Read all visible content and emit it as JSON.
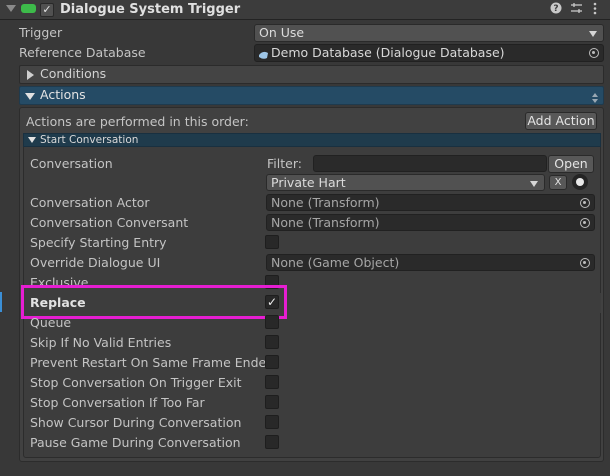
{
  "header": {
    "title": "Dialogue System Trigger"
  },
  "trigger": {
    "label": "Trigger",
    "value": "On Use"
  },
  "reference_database": {
    "label": "Reference Database",
    "value": "Demo Database (Dialogue Database)"
  },
  "conditions": {
    "label": "Conditions"
  },
  "actions": {
    "label": "Actions",
    "order_text": "Actions are performed in this order:",
    "add_action_label": "Add Action"
  },
  "start_conversation": {
    "label": "Start Conversation",
    "conversation": {
      "label": "Conversation",
      "filter_label": "Filter:",
      "filter_value": "",
      "open_label": "Open",
      "selected": "Private Hart",
      "clear_label": "X"
    },
    "conversation_actor": {
      "label": "Conversation Actor",
      "value": "None (Transform)"
    },
    "conversation_conversant": {
      "label": "Conversation Conversant",
      "value": "None (Transform)"
    },
    "specify_starting_entry": {
      "label": "Specify Starting Entry",
      "checked": false
    },
    "override_dialogue_ui": {
      "label": "Override Dialogue UI",
      "value": "None (Game Object)"
    },
    "exclusive": {
      "label": "Exclusive",
      "checked": false
    },
    "replace": {
      "label": "Replace",
      "checked": true
    },
    "queue": {
      "label": "Queue",
      "checked": false
    },
    "skip_if_no_valid_entries": {
      "label": "Skip If No Valid Entries",
      "checked": false
    },
    "prevent_restart": {
      "label": "Prevent Restart On Same Frame Ended",
      "checked": false
    },
    "stop_on_trigger_exit": {
      "label": "Stop Conversation On Trigger Exit",
      "checked": false
    },
    "stop_if_too_far": {
      "label": "Stop Conversation If Too Far",
      "checked": false
    },
    "show_cursor": {
      "label": "Show Cursor During Conversation",
      "checked": false
    },
    "pause_game": {
      "label": "Pause Game During Conversation",
      "checked": false
    }
  },
  "icons": {
    "component": "green-toggle-icon",
    "help": "help-icon",
    "presets": "sliders-icon",
    "context_menu": "kebab-icon",
    "object_picker": "target-icon",
    "database": "database-icon"
  },
  "colors": {
    "highlight": "#e61ed2",
    "actions_header": "#254b65",
    "component_icon": "#3dbb4a"
  }
}
